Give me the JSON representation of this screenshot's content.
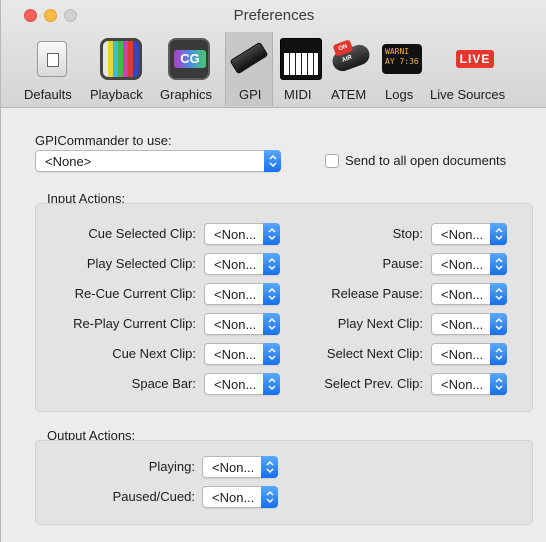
{
  "window": {
    "title": "Preferences"
  },
  "toolbar": {
    "items": [
      {
        "label": "Defaults",
        "icon": "defaults-icon"
      },
      {
        "label": "Playback",
        "icon": "playback-icon"
      },
      {
        "label": "Graphics",
        "icon": "graphics-icon"
      },
      {
        "label": "GPI",
        "icon": "gpi-icon",
        "selected": true
      },
      {
        "label": "MIDI",
        "icon": "midi-keyboard-icon"
      },
      {
        "label": "ATEM",
        "icon": "atem-icon"
      },
      {
        "label": "Logs",
        "icon": "logs-icon"
      },
      {
        "label": "Live Sources",
        "icon": "live-sources-icon"
      }
    ],
    "icon_text": {
      "graphics": "CG",
      "logs": "WARNI\nAY 7:36",
      "live": "LIVE",
      "atem": "ON AIR"
    }
  },
  "gpi": {
    "commander_label": "GPICommander to use:",
    "commander_value": "<None>",
    "send_all_label": "Send to all open documents",
    "send_all_checked": false
  },
  "input_actions": {
    "title": "Input Actions:",
    "left": [
      {
        "label": "Cue Selected Clip:",
        "value": "<Non..."
      },
      {
        "label": "Play Selected Clip:",
        "value": "<Non..."
      },
      {
        "label": "Re-Cue Current Clip:",
        "value": "<Non..."
      },
      {
        "label": "Re-Play Current Clip:",
        "value": "<Non..."
      },
      {
        "label": "Cue Next Clip:",
        "value": "<Non..."
      },
      {
        "label": "Space Bar:",
        "value": "<Non..."
      }
    ],
    "right": [
      {
        "label": "Stop:",
        "value": "<Non..."
      },
      {
        "label": "Pause:",
        "value": "<Non..."
      },
      {
        "label": "Release Pause:",
        "value": "<Non..."
      },
      {
        "label": "Play Next Clip:",
        "value": "<Non..."
      },
      {
        "label": "Select Next Clip:",
        "value": "<Non..."
      },
      {
        "label": "Select Prev. Clip:",
        "value": "<Non..."
      }
    ]
  },
  "output_actions": {
    "title": "Output Actions:",
    "items": [
      {
        "label": "Playing:",
        "value": "<Non..."
      },
      {
        "label": "Paused/Cued:",
        "value": "<Non..."
      }
    ]
  },
  "colors": {
    "accent": "#1670ec",
    "close": "#fc605c",
    "minimize": "#fdbc40",
    "live_red": "#e8352e"
  }
}
